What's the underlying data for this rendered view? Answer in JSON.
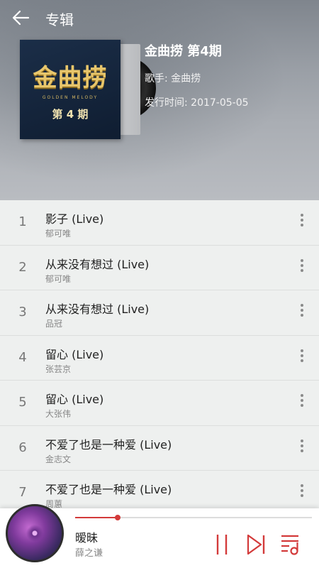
{
  "header": {
    "title": "专辑",
    "album": {
      "cover_logo": "金曲捞",
      "cover_subtitle": "GOLDEN MELODY",
      "cover_issue": "第 4 期",
      "name": "金曲捞 第4期",
      "singer": "歌手: 金曲捞",
      "release": "发行时间: 2017-05-05"
    }
  },
  "tracks": [
    {
      "num": "1",
      "title": "影子 (Live)",
      "artist": "郁可唯"
    },
    {
      "num": "2",
      "title": "从来没有想过 (Live)",
      "artist": "郁可唯"
    },
    {
      "num": "3",
      "title": "从来没有想过 (Live)",
      "artist": "品冠"
    },
    {
      "num": "4",
      "title": "留心 (Live)",
      "artist": "张芸京"
    },
    {
      "num": "5",
      "title": "留心 (Live)",
      "artist": "大张伟"
    },
    {
      "num": "6",
      "title": "不爱了也是一种爱 (Live)",
      "artist": "金志文"
    },
    {
      "num": "7",
      "title": "不爱了也是一种爱 (Live)",
      "artist": "周蕙"
    }
  ],
  "player": {
    "title": "暧昧",
    "artist": "薛之谦",
    "progress": 0.18,
    "accent": "#d33a3a"
  },
  "icons": {
    "back": "arrow-left-icon",
    "more": "more-vertical-icon",
    "pause": "pause-icon",
    "next": "skip-next-icon",
    "playlist": "playlist-icon"
  }
}
